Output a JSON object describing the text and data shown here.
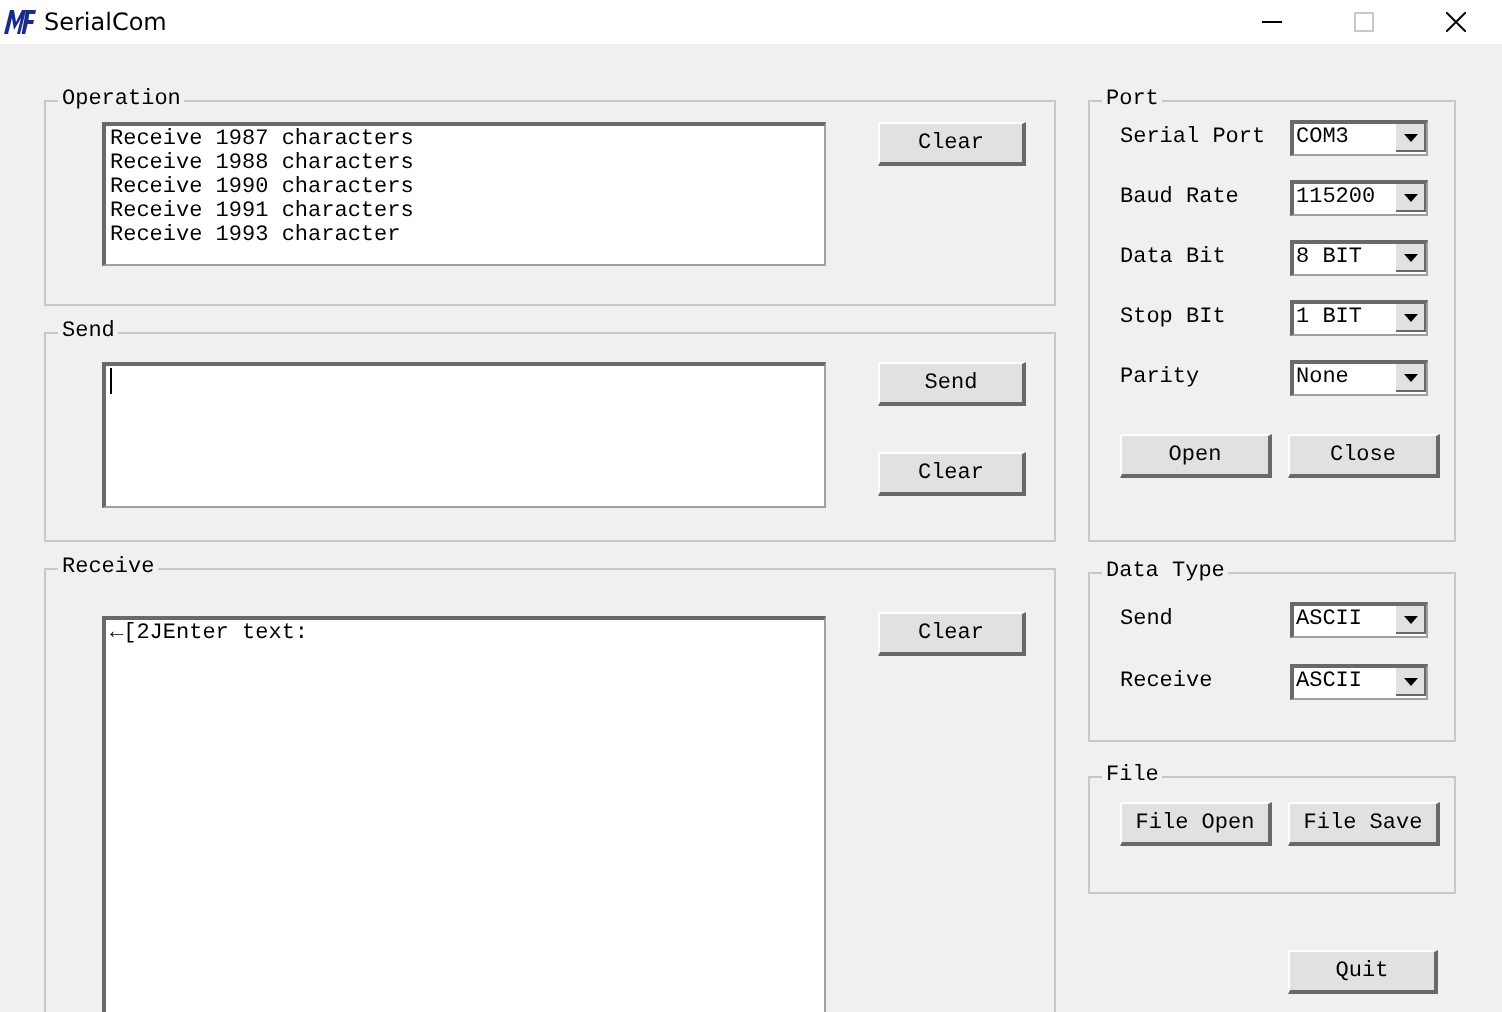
{
  "window": {
    "title": "SerialCom",
    "maximize_disabled": true
  },
  "operation": {
    "legend": "Operation",
    "lines": [
      "Receive 1987 characters",
      "Receive 1988 characters",
      "Receive 1990 characters",
      "Receive 1991 characters",
      "Receive 1993 character"
    ],
    "clear": "Clear"
  },
  "send": {
    "legend": "Send",
    "focused": true,
    "send": "Send",
    "clear": "Clear"
  },
  "receive": {
    "legend": "Receive",
    "lines": [
      "←[2JEnter text:"
    ],
    "clear": "Clear"
  },
  "port": {
    "legend": "Port",
    "fields": [
      {
        "label": "Serial Port",
        "value": "COM3"
      },
      {
        "label": "Baud Rate",
        "value": "115200"
      },
      {
        "label": "Data Bit",
        "value": "8 BIT"
      },
      {
        "label": "Stop BIt",
        "value": "1 BIT"
      },
      {
        "label": "Parity",
        "value": "None"
      }
    ],
    "buttons": [
      "Open",
      "Close"
    ]
  },
  "data_type": {
    "legend": "Data Type",
    "fields": [
      {
        "label": "Send",
        "value": "ASCII"
      },
      {
        "label": "Receive",
        "value": "ASCII"
      }
    ]
  },
  "file": {
    "legend": "File",
    "buttons": [
      "File Open",
      "File Save"
    ]
  },
  "quit": "Quit"
}
